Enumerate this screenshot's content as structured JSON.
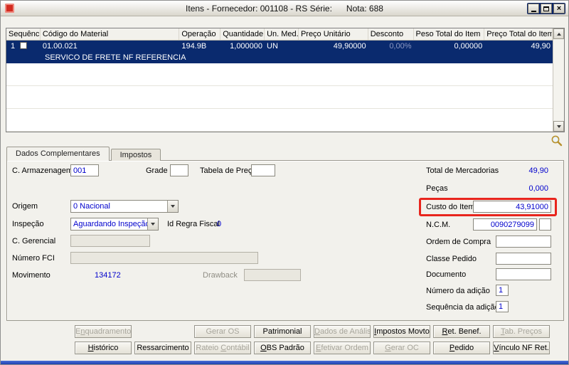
{
  "window": {
    "title": "Itens - Fornecedor: 001108 - RS Série:      Nota: 688",
    "controls": {
      "close_glyph": "×"
    }
  },
  "grid": {
    "columns": [
      "Sequência",
      "Código do Material",
      "Operação",
      "Quantidade",
      "Un. Med.",
      "Preço Unitário",
      "Desconto",
      "Peso Total do Item",
      "Preço Total do Item"
    ],
    "rows": [
      {
        "sequencia": "1",
        "codigo_material": "01.00.021",
        "descricao": "SERVICO DE FRETE NF REFERENCIA",
        "operacao": "194.9B",
        "quantidade": "1,000000",
        "un_med": "UN",
        "preco_unitario": "49,90000",
        "desconto": "0,00%",
        "peso_total_item": "0,00000",
        "preco_total_item": "49,90",
        "selected": true,
        "checked": false
      }
    ]
  },
  "tabs": [
    {
      "label": "Dados Complementares",
      "active": true
    },
    {
      "label": "Impostos",
      "active": false
    }
  ],
  "form": {
    "c_armazenagem": {
      "label": "C. Armazenagem",
      "value": "001"
    },
    "grade": {
      "label": "Grade",
      "value": ""
    },
    "tabela_preco": {
      "label": "Tabela de Preço",
      "value": ""
    },
    "origem": {
      "label": "Origem",
      "value": "0 Nacional"
    },
    "inspecao": {
      "label": "Inspeção",
      "value": "Aguardando Inspeção"
    },
    "id_regra_fiscal": {
      "label": "Id Regra Fiscal",
      "value": "0"
    },
    "c_gerencial": {
      "label": "C. Gerencial",
      "value": "",
      "disabled": true
    },
    "numero_fci": {
      "label": "Número FCI",
      "value": "",
      "disabled": true
    },
    "movimento": {
      "label": "Movimento",
      "value": "134172"
    },
    "drawback": {
      "label": "Drawback",
      "value": "",
      "disabled": true
    },
    "total_mercadorias": {
      "label": "Total de Mercadorias",
      "value": "49,90"
    },
    "pecas": {
      "label": "Peças",
      "value": "0,000"
    },
    "custo_item": {
      "label": "Custo do Item",
      "value": "43,91000",
      "highlighted": true
    },
    "ncm": {
      "label": "N.C.M.",
      "value": "0090279099",
      "value2": ""
    },
    "ordem_compra": {
      "label": "Ordem de Compra",
      "value": ""
    },
    "classe_pedido": {
      "label": "Classe Pedido",
      "value": ""
    },
    "documento": {
      "label": "Documento",
      "value": ""
    },
    "numero_adicao": {
      "label": "Número da adição",
      "value": "1"
    },
    "sequencia_adicao": {
      "label": "Sequência da adição",
      "value": "1"
    }
  },
  "buttons": {
    "row1": [
      {
        "label": "Enquadramento",
        "enabled": false,
        "accel": 1
      },
      null,
      {
        "label": "Gerar OS",
        "enabled": false
      },
      {
        "label": "Patrimonial",
        "enabled": true
      },
      {
        "label": "Dados de Análise",
        "enabled": false,
        "accel": 0
      },
      {
        "label": "Impostos Movto",
        "enabled": true,
        "accel": 0
      },
      {
        "label": "Ret. Benef.",
        "enabled": true,
        "accel": 0
      },
      {
        "label": "Tab. Preços",
        "enabled": false,
        "accel": 0
      }
    ],
    "row2": [
      {
        "label": "Histórico",
        "enabled": true,
        "accel": 0
      },
      {
        "label": "Ressarcimento",
        "enabled": true
      },
      {
        "label": "Rateio Contábil",
        "enabled": false,
        "accel": 7
      },
      {
        "label": "OBS Padrão",
        "enabled": true,
        "accel": 0
      },
      {
        "label": "Efetivar Ordem",
        "enabled": false,
        "accel": 0
      },
      {
        "label": "Gerar OC",
        "enabled": false,
        "accel": 0
      },
      {
        "label": "Pedido",
        "enabled": true,
        "accel": 0
      },
      {
        "label": "Vínculo NF Ret.",
        "enabled": true,
        "accel": 0
      }
    ]
  },
  "colors": {
    "selection": "#0a2a6e",
    "value_blue": "#0000cc",
    "annotation_red": "#e8251d"
  }
}
